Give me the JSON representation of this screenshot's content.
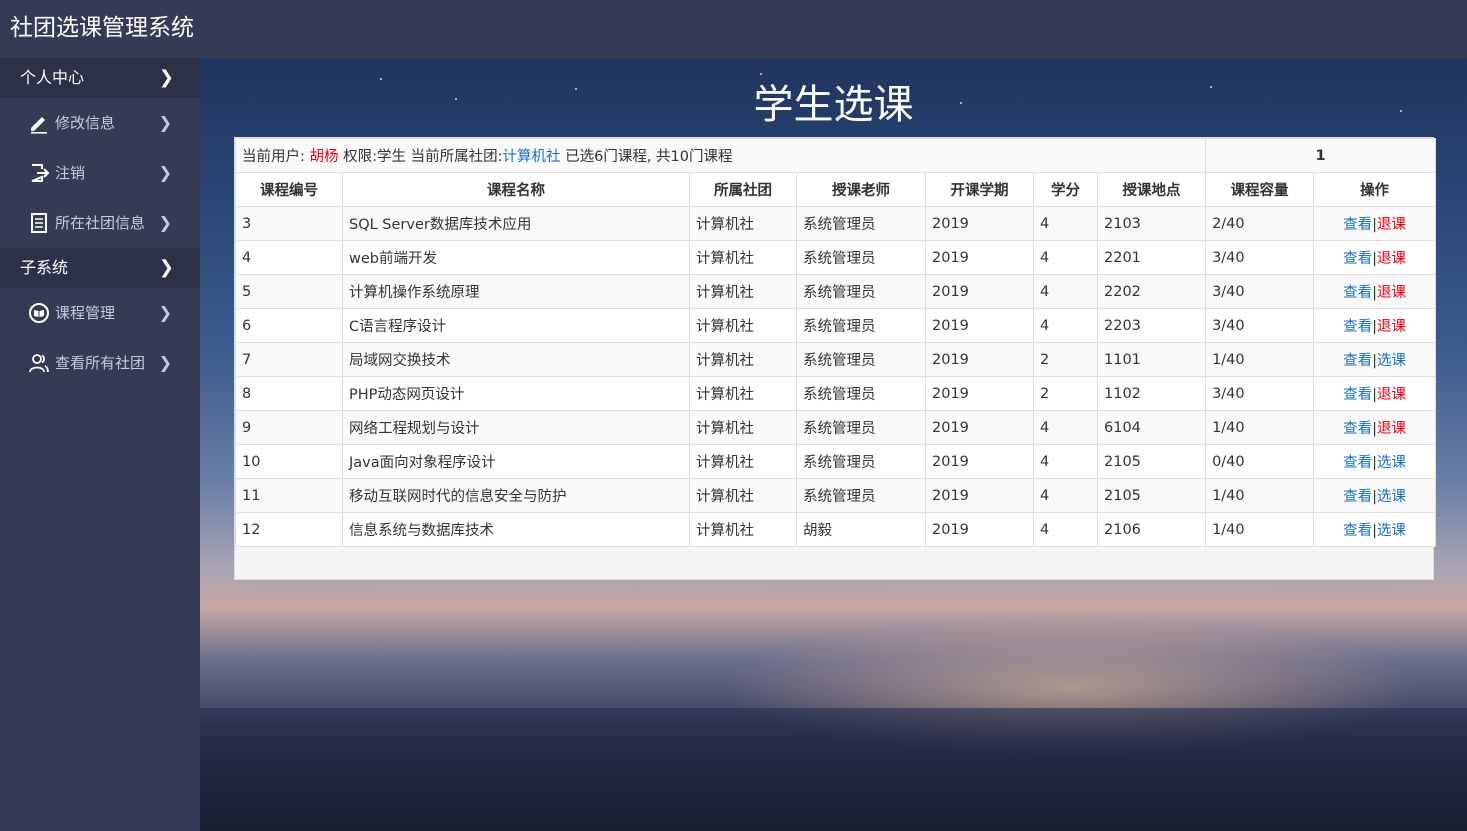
{
  "app": {
    "title": "社团选课管理系统"
  },
  "sidebar": {
    "sections": [
      {
        "label": "个人中心",
        "items": [
          {
            "label": "修改信息",
            "icon": "edit-icon"
          },
          {
            "label": "注销",
            "icon": "logout-icon"
          },
          {
            "label": "所在社团信息",
            "icon": "document-icon"
          }
        ]
      },
      {
        "label": "子系统",
        "items": [
          {
            "label": "课程管理",
            "icon": "book-icon"
          },
          {
            "label": "查看所有社团",
            "icon": "users-icon"
          }
        ]
      }
    ]
  },
  "main": {
    "heading": "学生选课",
    "info": {
      "user_prefix": "当前用户: ",
      "user_name": "胡杨",
      "role_text": " 权限:学生  当前所属社团:",
      "club_name": "计算机社",
      "summary": " 已选6门课程,  共10门课程",
      "page": "1"
    },
    "table": {
      "headers": [
        "课程编号",
        "课程名称",
        "所属社团",
        "授课老师",
        "开课学期",
        "学分",
        "授课地点",
        "课程容量",
        "操作"
      ],
      "view_label": "查看",
      "separator": "|",
      "rows": [
        {
          "id": "3",
          "name": "SQL Server数据库技术应用",
          "club": "计算机社",
          "teacher": "系统管理员",
          "term": "2019",
          "credit": "4",
          "location": "2103",
          "capacity": "2/40",
          "action": "退课"
        },
        {
          "id": "4",
          "name": "web前端开发",
          "club": "计算机社",
          "teacher": "系统管理员",
          "term": "2019",
          "credit": "4",
          "location": "2201",
          "capacity": "3/40",
          "action": "退课"
        },
        {
          "id": "5",
          "name": "计算机操作系统原理",
          "club": "计算机社",
          "teacher": "系统管理员",
          "term": "2019",
          "credit": "4",
          "location": "2202",
          "capacity": "3/40",
          "action": "退课"
        },
        {
          "id": "6",
          "name": "C语言程序设计",
          "club": "计算机社",
          "teacher": "系统管理员",
          "term": "2019",
          "credit": "4",
          "location": "2203",
          "capacity": "3/40",
          "action": "退课"
        },
        {
          "id": "7",
          "name": "局域网交换技术",
          "club": "计算机社",
          "teacher": "系统管理员",
          "term": "2019",
          "credit": "2",
          "location": "1101",
          "capacity": "1/40",
          "action": "选课"
        },
        {
          "id": "8",
          "name": "PHP动态网页设计",
          "club": "计算机社",
          "teacher": "系统管理员",
          "term": "2019",
          "credit": "2",
          "location": "1102",
          "capacity": "3/40",
          "action": "退课"
        },
        {
          "id": "9",
          "name": "网络工程规划与设计",
          "club": "计算机社",
          "teacher": "系统管理员",
          "term": "2019",
          "credit": "4",
          "location": "6104",
          "capacity": "1/40",
          "action": "退课"
        },
        {
          "id": "10",
          "name": "Java面向对象程序设计",
          "club": "计算机社",
          "teacher": "系统管理员",
          "term": "2019",
          "credit": "4",
          "location": "2105",
          "capacity": "0/40",
          "action": "选课"
        },
        {
          "id": "11",
          "name": "移动互联网时代的信息安全与防护",
          "club": "计算机社",
          "teacher": "系统管理员",
          "term": "2019",
          "credit": "4",
          "location": "2105",
          "capacity": "1/40",
          "action": "选课"
        },
        {
          "id": "12",
          "name": "信息系统与数据库技术",
          "club": "计算机社",
          "teacher": "胡毅",
          "term": "2019",
          "credit": "4",
          "location": "2106",
          "capacity": "1/40",
          "action": "选课"
        }
      ]
    }
  },
  "colors": {
    "drop_action": "#e60012",
    "select_action": "#1a6fbf",
    "sidebar": "#353b55"
  }
}
